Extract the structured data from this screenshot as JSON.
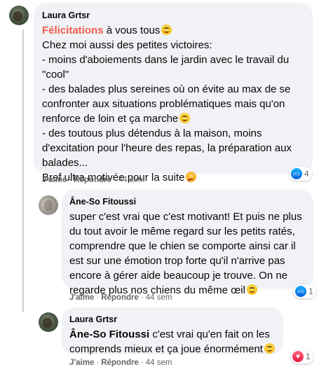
{
  "comments": [
    {
      "author": "Laura Grtsr",
      "highlight": "Félicitations",
      "lines": [
        " à vous tous",
        "Chez moi aussi des petites victoires:",
        "- moins d'aboiements dans le jardin avec le travail du",
        "\"cool\"",
        "- des balades plus sereines où on évite au max de se",
        "confronter aux situations problématiques mais qu'on",
        "renforce de loin et ça marche",
        "- des toutous plus détendus à la maison, moins",
        "d'excitation pour l'heure des repas, la préparation aux",
        "balades...",
        "Bref ultra motivée pour la suite"
      ],
      "like_label": "J'aime",
      "reply_label": "Répondre",
      "time": "44 sem",
      "reaction_count": "4",
      "reaction_icon": "like-icon"
    },
    {
      "author": "Âne-So Fitoussi",
      "lines": [
        "super c'est vrai que c'est motivant! Et puis ne plus",
        "du tout avoir le même regard sur les petits ratés,",
        "comprendre que le chien se comporte ainsi car il",
        "est sur une émotion trop forte qu'il n'arrive pas",
        "encore à gérer aide beaucoup je trouve. On ne",
        "regarde plus nos chiens du même œil"
      ],
      "like_label": "J'aime",
      "reply_label": "Répondre",
      "time": "44 sem",
      "reaction_count": "1",
      "reaction_icon": "like-icon"
    },
    {
      "author": "Laura Grtsr",
      "mention": "Âne-So Fitoussi",
      "lines": [
        " c'est vrai qu'en fait on les",
        "comprends mieux et ça joue énormément"
      ],
      "like_label": "J'aime",
      "reply_label": "Répondre",
      "time": "44 sem",
      "reaction_count": "1",
      "reaction_icon": "heart-icon"
    }
  ],
  "colors": {
    "bubble": "#f0f2f5",
    "highlight": "#f15b4e",
    "like": "#0062df",
    "heart": "#e61739",
    "meta": "#65676b"
  }
}
